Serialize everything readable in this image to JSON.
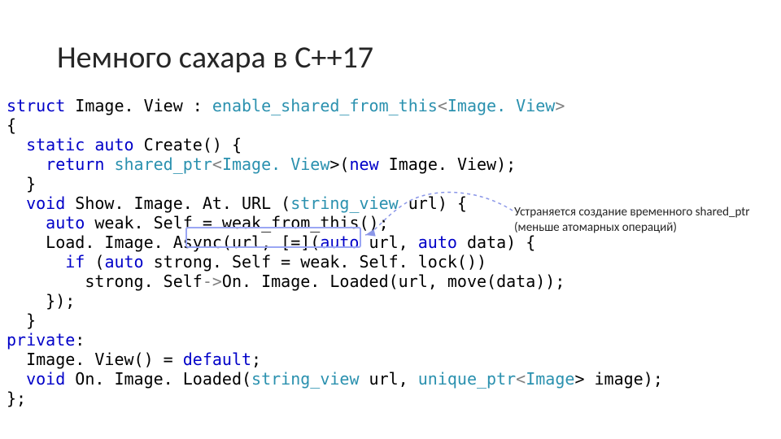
{
  "title": "Немного сахара в C++17",
  "code": {
    "l1a": "struct",
    "l1b": " Image. View : ",
    "l1c": "enable_shared_from_this",
    "l1d": "<",
    "l1e": "Image. View",
    "l1f": ">",
    "l2": "{",
    "l3a": "  ",
    "l3b": "static",
    "l3c": " ",
    "l3d": "auto",
    "l3e": " Create() {",
    "l4a": "    ",
    "l4b": "return",
    "l4c": " ",
    "l4d": "shared_ptr",
    "l4e": "<",
    "l4f": "Image. View",
    "l4g": ">(",
    "l4h": "new",
    "l4i": " Image. View);",
    "l5": "  }",
    "l6a": "  ",
    "l6b": "void",
    "l6c": " Show. Image. At. URL (",
    "l6d": "string_view",
    "l6e": " url) {",
    "l7a": "    ",
    "l7b": "auto",
    "l7c": " weak. Self = weak_from_this();",
    "l8a": "    Load. Image. Async(url, [=](",
    "l8b": "auto",
    "l8c": " url, ",
    "l8d": "auto",
    "l8e": " data) {",
    "l9a": "      ",
    "l9b": "if",
    "l9c": " (",
    "l9d": "auto",
    "l9e": " strong. Self = weak. Self. lock())",
    "l10a": "        strong. Self",
    "l10b": "->",
    "l10c": "On. Image. Loaded(url, move(data));",
    "l11": "    });",
    "l12": "  }",
    "l13a": "",
    "l13b": "private",
    "l13c": ":",
    "l14a": "  Image. View() = ",
    "l14b": "default",
    "l14c": ";",
    "l15a": "  ",
    "l15b": "void",
    "l15c": " On. Image. Loaded(",
    "l15d": "string_view",
    "l15e": " url, ",
    "l15f": "unique_ptr",
    "l15g": "<",
    "l15h": "Image",
    "l15i": "> image);",
    "l16": "};"
  },
  "annotation": "Устраняется создание временного shared_ptr (меньше атомарных операций)"
}
